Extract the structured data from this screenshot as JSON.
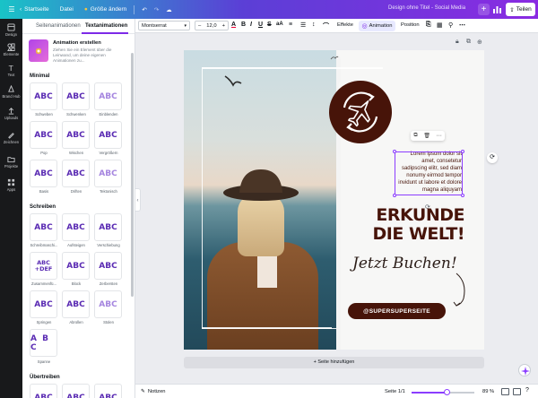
{
  "topbar": {
    "home": "Startseite",
    "file": "Datei",
    "resize": "Größe ändern",
    "doc_title": "Design ohne Titel - Social Media",
    "share": "Teilen"
  },
  "rail": [
    {
      "label": "Design",
      "icon": "design-icon"
    },
    {
      "label": "Elemente",
      "icon": "elements-icon"
    },
    {
      "label": "Text",
      "icon": "text-icon"
    },
    {
      "label": "Brand Hub",
      "icon": "brand-icon"
    },
    {
      "label": "Uploads",
      "icon": "upload-icon"
    },
    {
      "label": "Zeichnen",
      "icon": "draw-icon"
    },
    {
      "label": "Projekte",
      "icon": "folder-icon"
    },
    {
      "label": "Apps",
      "icon": "apps-icon"
    }
  ],
  "panel": {
    "tab_page": "Seitenanimationen",
    "tab_text": "Textanimationen",
    "card_title": "Animation erstellen",
    "card_desc": "Ziehen Sie ein Element über die Leinwand, um deine eigenen Animationen zu...",
    "section_minimal": "Minimal",
    "section_write": "Schreiben",
    "section_exaggerate": "Übertreiben",
    "minimal": [
      "Schweben",
      "Schwenken",
      "Einblenden",
      "Pop",
      "Wischen",
      "Vergrößern",
      "Basis",
      "Driften",
      "Tektonisch"
    ],
    "write": [
      "Schreibmaschi...",
      "Aufsteigen",
      "Verschiebung",
      "Zusammenfü...",
      "Block",
      "Zerbersten",
      "Springen",
      "Abrollen",
      "Stolen",
      "Spanne"
    ],
    "tile_text": "ABC",
    "tile_text2": "ABC\n+DEF",
    "tile_text3": "A B C"
  },
  "toolbar": {
    "font": "Montserrat",
    "size": "12,0",
    "effects": "Effekte",
    "animation": "Animation",
    "position": "Position"
  },
  "design": {
    "lorem": "Lorem ipsum dolor sit amet, consetetur sadipscing elitr, sed diam nonumy eirmod tempor invidunt ut labore et dolore magna aliquyam",
    "headline1": "ERKUNDE",
    "headline2": "DIE WELT!",
    "script": "Jetzt Buchen!",
    "handle": "@SUPERSUPERSEITE"
  },
  "canvas": {
    "add_page": "+ Seite hinzufügen"
  },
  "bottombar": {
    "notes": "Notizen",
    "pages": "Seite 1/1",
    "zoom": "89 %",
    "zoom_value": 0.89
  },
  "colors": {
    "brown": "#471409",
    "accent": "#8b3dff"
  }
}
